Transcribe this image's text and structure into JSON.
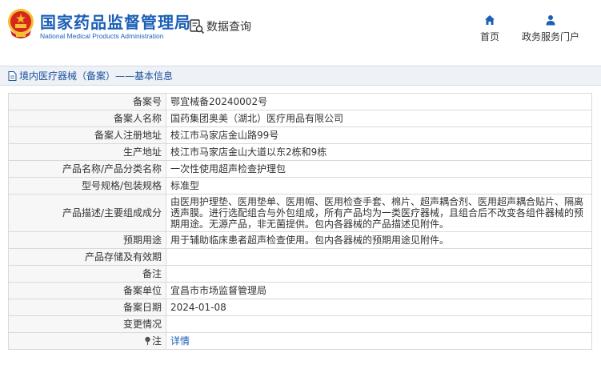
{
  "header": {
    "logo_cn": "国家药品监督管理局",
    "logo_en": "National Medical Products Administration",
    "query_label": "数据查询",
    "home_label": "首页",
    "gov_label": "政务服务门户"
  },
  "section": {
    "title": "境内医疗器械（备案）——基本信息"
  },
  "rows": [
    {
      "label": "备案号",
      "value": "鄂宜械备20240002号"
    },
    {
      "label": "备案人名称",
      "value": "国药集团奥美（湖北）医疗用品有限公司"
    },
    {
      "label": "备案人注册地址",
      "value": "枝江市马家店金山路99号"
    },
    {
      "label": "生产地址",
      "value": "枝江市马家店金山大道以东2栋和9栋"
    },
    {
      "label": "产品名称/产品分类名称",
      "value": "一次性使用超声检查护理包"
    },
    {
      "label": "型号规格/包装规格",
      "value": "标准型"
    },
    {
      "label": "产品描述/主要组成成分",
      "value": "由医用护理垫、医用垫单、医用帽、医用检查手套、棉片、超声耦合剂、医用超声耦合贴片、隔离透声膜。进行选配组合与外包组成，所有产品均为一类医疗器械，且组合后不改变各组件器械的预期用途。无源产品，非无菌提供。包内各器械的产品描述见附件。"
    },
    {
      "label": "预期用途",
      "value": "用于辅助临床患者超声检查使用。包内各器械的预期用途见附件。"
    },
    {
      "label": "产品存储及有效期",
      "value": ""
    },
    {
      "label": "备注",
      "value": ""
    },
    {
      "label": "备案单位",
      "value": "宜昌市市场监督管理局"
    },
    {
      "label": "备案日期",
      "value": "2024-01-08"
    },
    {
      "label": "变更情况",
      "value": ""
    },
    {
      "label": "注",
      "value": "详情"
    }
  ],
  "colors": {
    "brand_blue": "#1b5fb6",
    "emblem_red": "#d7261b",
    "emblem_gold": "#f2c033"
  },
  "icons": {
    "emblem": "national-emblem-icon",
    "query": "document-search-icon",
    "home": "home-icon",
    "gov": "user-icon",
    "title": "document-icon",
    "note": "pin-icon"
  }
}
